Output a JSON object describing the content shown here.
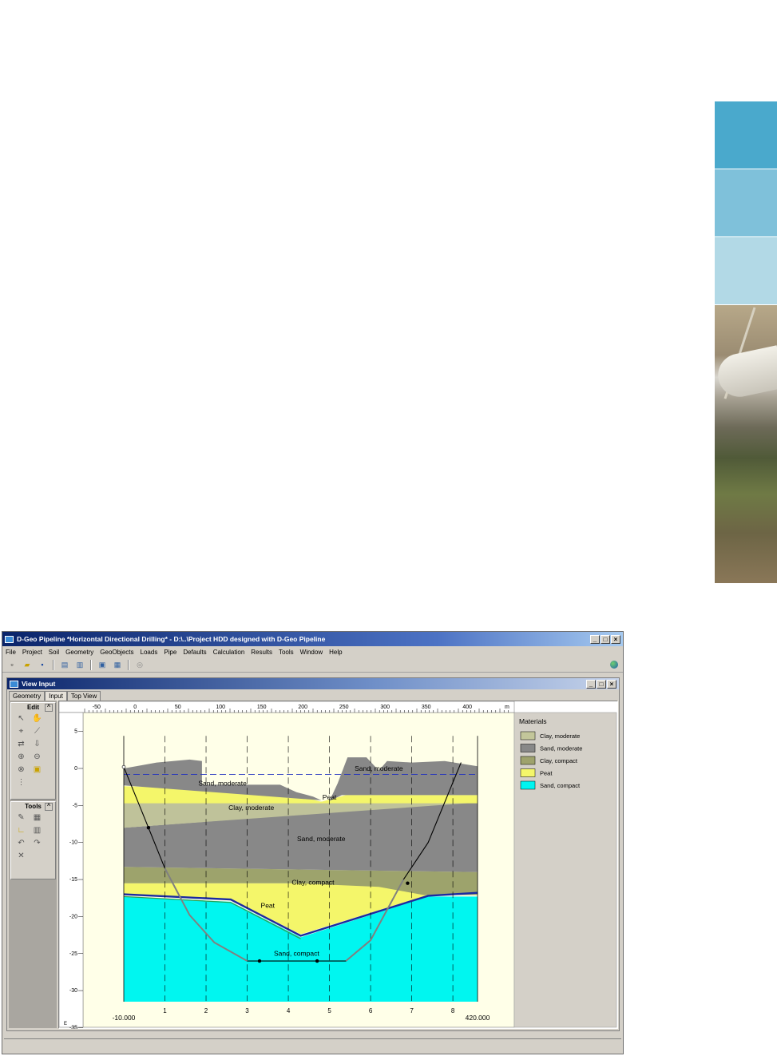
{
  "app": {
    "title": "D-Geo Pipeline *Horizontal Directional Drilling* - D:\\..\\Project HDD designed with D-Geo Pipeline",
    "menu": [
      "File",
      "Project",
      "Soil",
      "Geometry",
      "GeoObjects",
      "Loads",
      "Pipe",
      "Defaults",
      "Calculation",
      "Results",
      "Tools",
      "Window",
      "Help"
    ],
    "window_buttons": [
      "_",
      "□",
      "×"
    ]
  },
  "view": {
    "title": "View Input",
    "tabs": [
      "Geometry",
      "Input",
      "Top View"
    ],
    "active_tab": "Input",
    "edit_panel": "Edit",
    "tools_panel": "Tools"
  },
  "legend": {
    "title": "Materials",
    "items": [
      {
        "label": "Clay, moderate",
        "color": "#c3c69a"
      },
      {
        "label": "Sand, moderate",
        "color": "#888888"
      },
      {
        "label": "Clay, compact",
        "color": "#9ea26c"
      },
      {
        "label": "Peat",
        "color": "#f4f66a"
      },
      {
        "label": "Sand, compact",
        "color": "#00f5f0"
      }
    ]
  },
  "chart_data": {
    "type": "area",
    "top_ruler": [
      "-50",
      "0",
      "50",
      "100",
      "150",
      "200",
      "250",
      "300",
      "350",
      "400",
      "m"
    ],
    "left_ruler": [
      "5",
      "0",
      "-5",
      "-10",
      "-15",
      "-20",
      "-25",
      "-30",
      "-35"
    ],
    "left_ruler_unit": "E",
    "verticals": [
      "1",
      "2",
      "3",
      "4",
      "5",
      "6",
      "7",
      "8"
    ],
    "x_start": "-10.000",
    "x_end": "420.000",
    "x_range": [
      -10,
      420
    ],
    "y_range": [
      -35,
      6
    ],
    "layer_labels": [
      {
        "text": "Sand, moderate",
        "x": 110,
        "y": -2.3
      },
      {
        "text": "Sand, moderate",
        "x": 300,
        "y": -0.3
      },
      {
        "text": "Peat",
        "x": 240,
        "y": -4.2
      },
      {
        "text": "Clay, moderate",
        "x": 145,
        "y": -5.6
      },
      {
        "text": "Sand, moderate",
        "x": 230,
        "y": -9.8
      },
      {
        "text": "Clay, compact",
        "x": 220,
        "y": -15.7
      },
      {
        "text": "Peat",
        "x": 165,
        "y": -18.8
      },
      {
        "text": "Sand, compact",
        "x": 200,
        "y": -25.3
      }
    ]
  }
}
